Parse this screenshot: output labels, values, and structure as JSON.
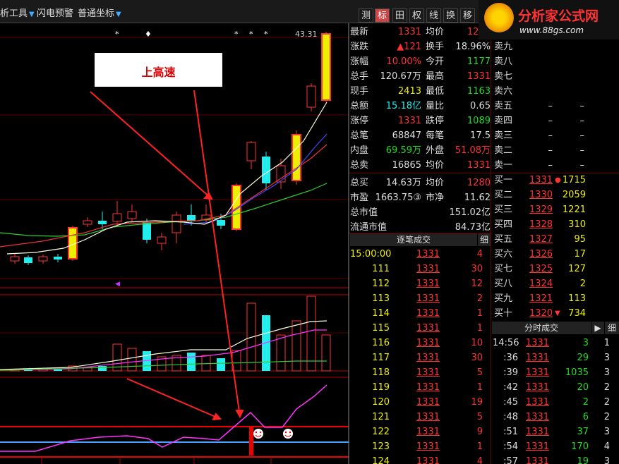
{
  "toolbar": {
    "left_items": [
      "析工具",
      "闪电预警",
      "普通坐标"
    ],
    "right_items": [
      "测",
      "标",
      "田",
      "权",
      "线",
      "换",
      "移",
      "☐"
    ]
  },
  "logo": {
    "title": "分析家公式网",
    "url": "www.88gs.com"
  },
  "callout": {
    "text": "上高速"
  },
  "chart_marks": {
    "top_label": "43.31"
  },
  "quote": {
    "rows": [
      {
        "l1": "最新",
        "v1": "1331",
        "l2": "均价",
        "v2": "1280",
        "c1": "red",
        "c2": "red"
      },
      {
        "l1": "涨跌",
        "v1": "▲121",
        "l2": "换手",
        "v2": "18.96%",
        "c1": "red",
        "c2": "wht"
      },
      {
        "l1": "涨幅",
        "v1": "10.00%",
        "l2": "今开",
        "v2": "1177",
        "c1": "red",
        "c2": "grn"
      },
      {
        "l1": "总手",
        "v1": "120.67万",
        "l2": "最高",
        "v2": "1331",
        "c1": "wht",
        "c2": "red"
      },
      {
        "l1": "现手",
        "v1": "2413",
        "l2": "最低",
        "v2": "1163",
        "c1": "yel",
        "c2": "grn"
      },
      {
        "l1": "总额",
        "v1": "15.18亿",
        "l2": "量比",
        "v2": "0.65",
        "c1": "cyn",
        "c2": "wht"
      },
      {
        "l1": "涨停",
        "v1": "1331",
        "l2": "跌停",
        "v2": "1089",
        "c1": "red",
        "c2": "grn"
      },
      {
        "l1": "总笔",
        "v1": "68847",
        "l2": "每笔",
        "v2": "17.5",
        "c1": "wht",
        "c2": "wht"
      },
      {
        "l1": "内盘",
        "v1": "69.59万",
        "l2": "外盘",
        "v2": "51.08万",
        "c1": "grn",
        "c2": "red"
      },
      {
        "l1": "总卖",
        "v1": "16865",
        "l2": "均价",
        "v2": "1331",
        "c1": "wht",
        "c2": "red"
      },
      {
        "l1": "总买",
        "v1": "14.63万",
        "l2": "均价",
        "v2": "1280",
        "c1": "wht",
        "c2": "red"
      },
      {
        "l1": "市盈",
        "v1": "1663.75③",
        "l2": "市净",
        "v2": "11.62",
        "c1": "wht",
        "c2": "wht"
      },
      {
        "l1": "总市值",
        "v1": "",
        "l2": "",
        "v2": "151.02亿",
        "c1": "wht",
        "c2": "wht"
      },
      {
        "l1": "流通市值",
        "v1": "",
        "l2": "",
        "v2": "84.73亿",
        "c1": "wht",
        "c2": "wht"
      }
    ],
    "asks": [
      {
        "label": "卖九",
        "price": "",
        "vol": ""
      },
      {
        "label": "卖八",
        "price": "",
        "vol": ""
      },
      {
        "label": "卖七",
        "price": "",
        "vol": ""
      },
      {
        "label": "卖六",
        "price": "",
        "vol": ""
      },
      {
        "label": "卖五",
        "price": "–",
        "vol": "–"
      },
      {
        "label": "卖四",
        "price": "–",
        "vol": "–"
      },
      {
        "label": "卖三",
        "price": "–",
        "vol": "–"
      },
      {
        "label": "卖二",
        "price": "–",
        "vol": "–"
      },
      {
        "label": "卖一",
        "price": "–",
        "vol": "–"
      }
    ],
    "bids": [
      {
        "label": "买一",
        "price": "1331",
        "vol": "1715",
        "mark": "●"
      },
      {
        "label": "买二",
        "price": "1330",
        "vol": "2059",
        "mark": ""
      },
      {
        "label": "买三",
        "price": "1329",
        "vol": "1221",
        "mark": ""
      },
      {
        "label": "买四",
        "price": "1328",
        "vol": "310",
        "mark": ""
      },
      {
        "label": "买五",
        "price": "1327",
        "vol": "95",
        "mark": ""
      },
      {
        "label": "买六",
        "price": "1326",
        "vol": "17",
        "mark": ""
      },
      {
        "label": "买七",
        "price": "1325",
        "vol": "127",
        "mark": ""
      },
      {
        "label": "买八",
        "price": "1324",
        "vol": "2",
        "mark": ""
      },
      {
        "label": "买九",
        "price": "1321",
        "vol": "113",
        "mark": ""
      },
      {
        "label": "买十",
        "price": "1320",
        "vol": "734",
        "mark": "▼"
      }
    ]
  },
  "trades": {
    "header": "逐笔成交",
    "detail_btn": "细",
    "rows": [
      {
        "id": "15:00:00",
        "price": "1331",
        "vol": "4"
      },
      {
        "id": "111",
        "price": "1331",
        "vol": "30"
      },
      {
        "id": "112",
        "price": "1331",
        "vol": "12"
      },
      {
        "id": "113",
        "price": "1331",
        "vol": "2"
      },
      {
        "id": "114",
        "price": "1331",
        "vol": "1"
      },
      {
        "id": "115",
        "price": "1331",
        "vol": "1"
      },
      {
        "id": "116",
        "price": "1331",
        "vol": "10"
      },
      {
        "id": "117",
        "price": "1331",
        "vol": "30"
      },
      {
        "id": "118",
        "price": "1331",
        "vol": "5"
      },
      {
        "id": "119",
        "price": "1331",
        "vol": "1"
      },
      {
        "id": "120",
        "price": "1331",
        "vol": "19"
      },
      {
        "id": "121",
        "price": "1331",
        "vol": "5"
      },
      {
        "id": "122",
        "price": "1331",
        "vol": "9"
      },
      {
        "id": "123",
        "price": "1331",
        "vol": "1"
      },
      {
        "id": "124",
        "price": "1331",
        "vol": "4"
      }
    ]
  },
  "minute": {
    "header": "分时成交",
    "arrow_btn": "▶",
    "detail_btn": "细",
    "rows": [
      {
        "t": "14:56",
        "price": "1331",
        "vol": "3",
        "n": "1"
      },
      {
        "t": ":36",
        "price": "1331",
        "vol": "29",
        "n": "3"
      },
      {
        "t": ":39",
        "price": "1331",
        "vol": "1035",
        "n": "3"
      },
      {
        "t": ":42",
        "price": "1331",
        "vol": "20",
        "n": "2"
      },
      {
        "t": ":45",
        "price": "1331",
        "vol": "2",
        "n": "2"
      },
      {
        "t": ":48",
        "price": "1331",
        "vol": "6",
        "n": "2"
      },
      {
        "t": ":51",
        "price": "1331",
        "vol": "37",
        "n": "3"
      },
      {
        "t": ":54",
        "price": "1331",
        "vol": "170",
        "n": "4"
      },
      {
        "t": ":57",
        "price": "1331",
        "vol": "19",
        "n": "3"
      }
    ]
  }
}
